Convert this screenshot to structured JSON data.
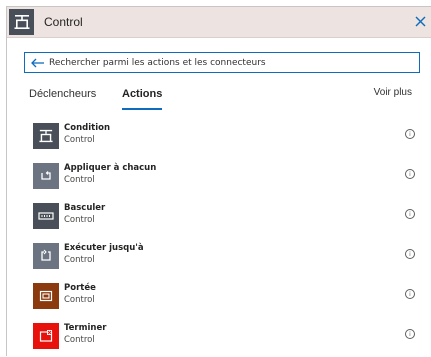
{
  "header": {
    "title": "Control",
    "icon": "control-icon",
    "close_icon": "close-icon",
    "background": "#ede3e1"
  },
  "search": {
    "value": "Rechercher parmi les actions et les connecteurs",
    "back_icon": "back-arrow-icon",
    "accent": "#0f6cbd"
  },
  "tabs": [
    {
      "label": "Déclencheurs",
      "active": false
    },
    {
      "label": "Actions",
      "active": true
    }
  ],
  "see_more": "Voir plus",
  "actions": [
    {
      "name": "Condition",
      "category": "Control",
      "icon": "condition-icon",
      "color": "#484f58"
    },
    {
      "name": "Appliquer à chacun",
      "category": "Control",
      "icon": "loop-icon",
      "color": "#6b7480"
    },
    {
      "name": "Basculer",
      "category": "Control",
      "icon": "switch-icon",
      "color": "#484f58"
    },
    {
      "name": "Exécuter jusqu'à",
      "category": "Control",
      "icon": "do-until-icon",
      "color": "#6b7480"
    },
    {
      "name": "Portée",
      "category": "Control",
      "icon": "scope-icon",
      "color": "#8b3a0e"
    },
    {
      "name": "Terminer",
      "category": "Control",
      "icon": "terminate-icon",
      "color": "#e8120c"
    }
  ]
}
